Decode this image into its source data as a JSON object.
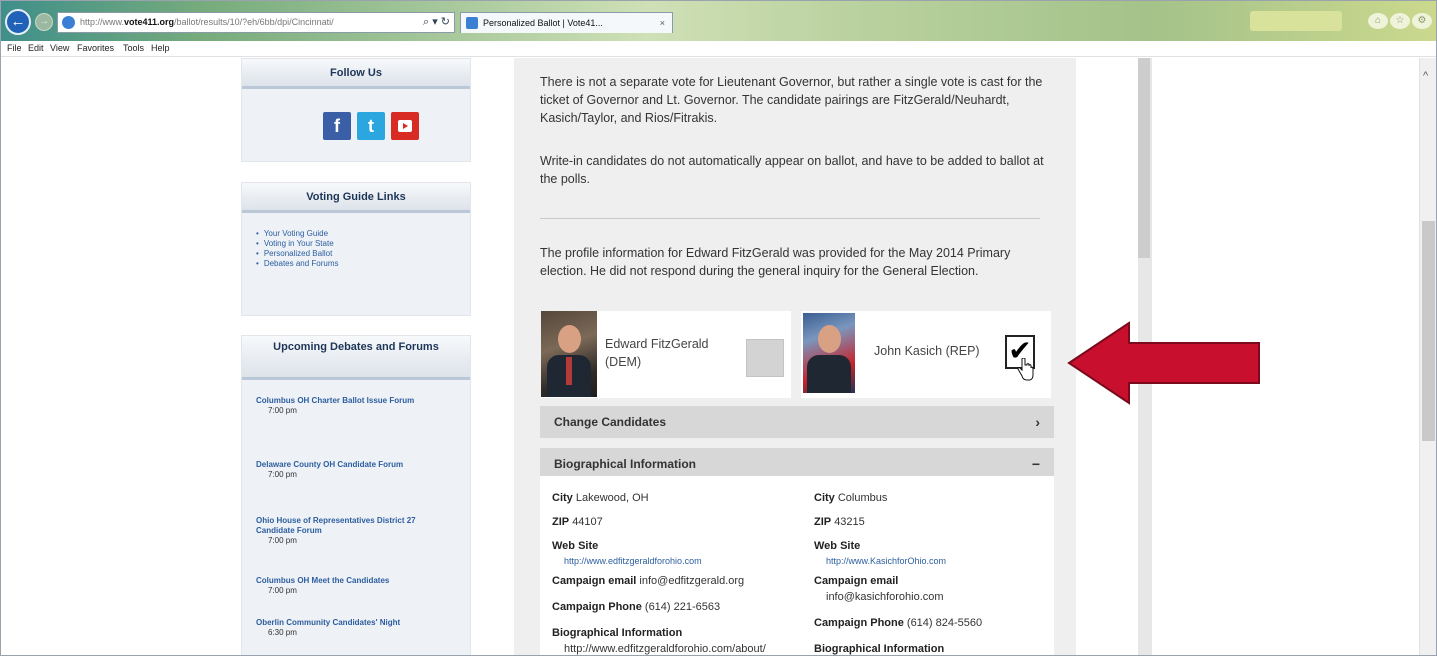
{
  "browser": {
    "address_prefix": "http://www.",
    "address_host": "vote411.org",
    "address_rest": "/ballot/results/10/?eh/6bb/dpi/Cincinnati/",
    "address_tools": "⌕ ▾ ↻",
    "tab_title": "Personalized Ballot | Vote41...",
    "tab_close": "×",
    "back": "←",
    "forward": "→",
    "home_glyph": "⌂",
    "star_glyph": "☆",
    "gear_glyph": "⚙"
  },
  "menu": {
    "file": "File",
    "edit": "Edit",
    "view": "View",
    "favorites": "Favorites",
    "tools": "Tools",
    "help": "Help"
  },
  "sidebar": {
    "follow_title": "Follow Us",
    "social": {
      "facebook": "f",
      "twitter": "t"
    },
    "guide_title": "Voting Guide Links",
    "guide_links": [
      "Your Voting Guide",
      "Voting in Your State",
      "Personalized Ballot",
      "Debates and Forums"
    ],
    "events_title": "Upcoming Debates and Forums",
    "events": [
      {
        "title": "Columbus OH Charter Ballot Issue Forum",
        "time": "7:00 pm"
      },
      {
        "title": "Delaware County OH Candidate Forum",
        "time": "7:00 pm"
      },
      {
        "title": "Ohio House of Representatives District 27 Candidate Forum",
        "time": "7:00 pm"
      },
      {
        "title": "Columbus OH Meet the Candidates",
        "time": "7:00 pm"
      },
      {
        "title": "Oberlin Community Candidates' Night",
        "time": "6:30 pm"
      }
    ]
  },
  "main": {
    "para1": "There is not a separate vote for Lieutenant Governor, but rather a single vote is cast for the ticket of Governor and Lt. Governor. The candidate pairings are FitzGerald/Neuhardt, Kasich/Taylor, and Rios/Fitrakis.",
    "para2": "Write-in candidates do not automatically appear on ballot, and have to be added to ballot at the polls.",
    "para3": "The profile information for Edward FitzGerald was provided for the May 2014 Primary election. He did not respond during the general inquiry for the General Election.",
    "candidates": [
      {
        "name_line1": "Edward FitzGerald",
        "name_line2": "(DEM)",
        "selected": false
      },
      {
        "name": "John Kasich (REP)",
        "selected": true,
        "check": "✔"
      }
    ],
    "change_candidates": "Change Candidates",
    "change_sign": "›",
    "bio_title": "Biographical Information",
    "bio_sign": "−",
    "bio": [
      {
        "city_label": "City",
        "city": "Lakewood, OH",
        "zip_label": "ZIP",
        "zip": "44107",
        "web_label": "Web Site",
        "web": "http://www.edfitzgeraldforohio.com",
        "email_label": "Campaign email",
        "email": "info@edfitzgerald.org",
        "phone_label": "Campaign Phone",
        "phone": "(614) 221-6563",
        "bioinfo_label": "Biographical Information",
        "bioinfo": "http://www.edfitzgeraldforohio.com/about/"
      },
      {
        "city_label": "City",
        "city": "Columbus",
        "zip_label": "ZIP",
        "zip": "43215",
        "web_label": "Web Site",
        "web": "http://www.KasichforOhio.com",
        "email_label": "Campaign email",
        "email": "info@kasichforohio.com",
        "phone_label": "Campaign Phone",
        "phone": "(614) 824-5560",
        "bioinfo_label": "Biographical Information"
      }
    ]
  },
  "colors": {
    "arrow": "#c8102e",
    "link": "#2c5ea0",
    "heading": "#1d3557"
  }
}
